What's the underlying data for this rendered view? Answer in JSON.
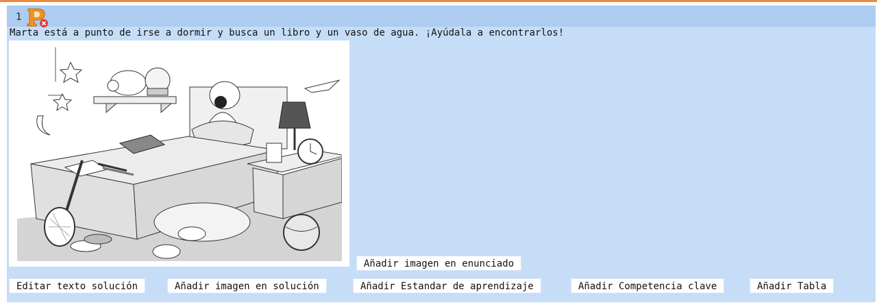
{
  "question": {
    "number": "1",
    "logo_icon": "p-badge-icon",
    "statement": "Marta está a punto de irse a dormir y busca un libro y un vaso de agua. ¡Ayúdala a encontrarlos!",
    "image_icon": "bedroom-illustration-icon"
  },
  "buttons": {
    "add_statement_image": "Añadir imagen en enunciado",
    "edit_solution_text": "Editar texto solución",
    "add_solution_image": "Añadir imagen en solución",
    "add_learning_standard": "Añadir Estandar de aprendizaje",
    "add_key_competence": "Añadir Competencia clave",
    "add_table": "Añadir Tabla"
  },
  "colors": {
    "accent_line": "#ee8a3a",
    "panel_bg": "#c6ddf8",
    "header_bg": "#aecbf0",
    "logo_orange": "#f0941f",
    "logo_badge_red": "#e23b3b"
  }
}
